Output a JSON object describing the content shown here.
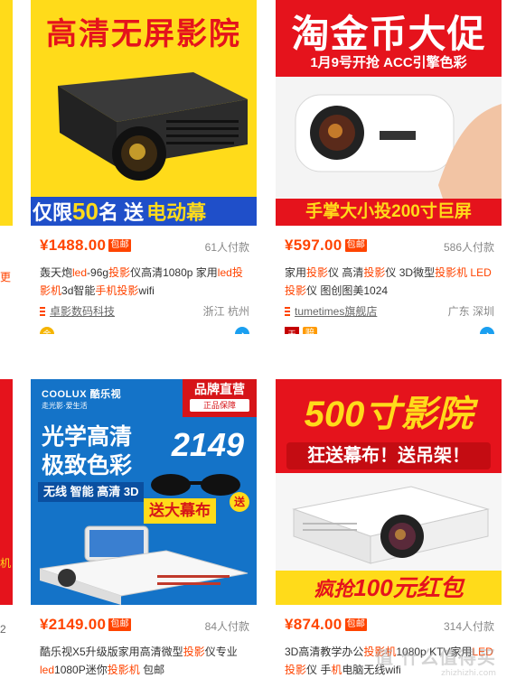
{
  "products": [
    {
      "banner_top": "高清无屏影院",
      "banner_bottom_a": "仅限",
      "banner_bottom_num": "50",
      "banner_bottom_b": "名 送",
      "banner_bottom_c": "电动幕",
      "price": "¥1488.00",
      "postage": "包邮",
      "sales": "61人付款",
      "title_parts": [
        "轰天炮",
        "led",
        "-96g",
        "投影",
        "仪高清1080p 家用",
        "led",
        "投",
        "影机",
        "3d智能",
        "手机",
        "投影",
        "wifi"
      ],
      "shop": "卓影数码科技",
      "location": "浙江 杭州"
    },
    {
      "banner_top": "淘金币大促",
      "banner_sub": "1月9号开抢  ACC引擎色彩",
      "banner_bottom": "手掌大小投200寸巨屏",
      "price": "¥597.00",
      "postage": "包邮",
      "sales": "586人付款",
      "title_parts": [
        "家用",
        "投影",
        "仪 高清",
        "投影",
        "仪 3D微型",
        "投影机",
        " LED ",
        "投影",
        "仪 图创图美1024"
      ],
      "shop": "tumetimes旗舰店",
      "location": "广东 深圳",
      "badge": "赔"
    },
    {
      "brand": "COOLUX 酷乐视",
      "brand_sub": "走光影·爱生活",
      "corner_a": "品牌直营",
      "corner_b": "正品保障",
      "headline_1": "光学高清",
      "headline_2": "极致色彩",
      "features": "无线 智能 高清 3D",
      "promo_price": "2149",
      "gift": "送大幕布",
      "gift_tag": "送",
      "price": "¥2149.00",
      "postage": "包邮",
      "sales": "84人付款",
      "title_parts": [
        "酷乐视X5升级版家用高清微型",
        "投影",
        "仪专业",
        "led",
        "1080P迷你",
        "投影机",
        " 包邮"
      ]
    },
    {
      "banner_top": "500寸影院",
      "banner_mid": "狂送幕布！送吊架！",
      "banner_bottom_a": "疯抢",
      "banner_bottom_b": "100元红包",
      "price": "¥874.00",
      "postage": "包邮",
      "sales": "314人付款",
      "title_parts": [
        "3D高清教学办公",
        "投影机",
        "1080p KTV家用",
        "LED",
        "投影",
        "仪 手",
        "机",
        "电脑无线wifi"
      ]
    }
  ],
  "left_fragments": {
    "top_char": "更",
    "mid_char": "机",
    "bottom_char": "2"
  },
  "watermark": {
    "main": "值 什么值得买",
    "sub": "zhizhizhi.com"
  },
  "colors": {
    "accent": "#ff4400",
    "banner_yellow": "#ffdb1a",
    "banner_red": "#e5131c",
    "banner_blue": "#1473c8",
    "wangwang": "#1a9ff0"
  },
  "icons": {
    "shop": "shop-stripes-icon",
    "chat": "wangwang-chat-icon",
    "gold": "gold-medal-icon"
  }
}
